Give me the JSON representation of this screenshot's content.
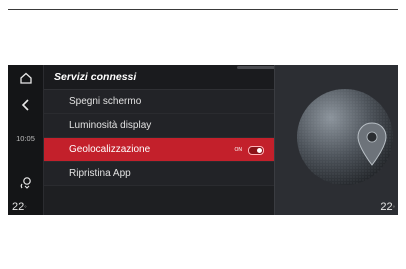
{
  "header": {
    "title": "Servizi connessi"
  },
  "sidebar": {
    "time": "10:05"
  },
  "menu": {
    "items": [
      {
        "label": "Spegni schermo"
      },
      {
        "label": "Luminosità display"
      },
      {
        "label": "Geolocalizzazione",
        "toggle_label": "ON",
        "active": true
      },
      {
        "label": "Ripristina App"
      }
    ]
  },
  "climate": {
    "left_temp": "22",
    "right_temp": "22",
    "unit": "°"
  },
  "icons": [
    "home-icon",
    "back-arrow-icon",
    "voice-icon",
    "location-pin-icon"
  ],
  "colors": {
    "accent": "#c3202b",
    "background": "#1e1f22"
  }
}
